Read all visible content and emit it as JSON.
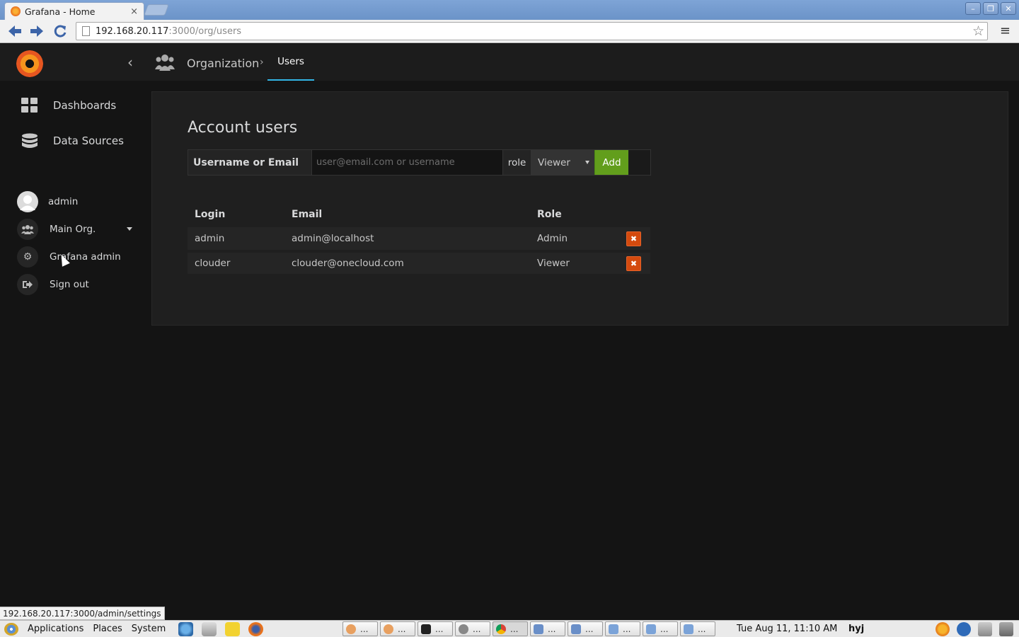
{
  "browser": {
    "tab_title": "Grafana - Home",
    "tab_close": "×",
    "url_host": "192.168.20.117",
    "url_path": ":3000/org/users",
    "status_url": "192.168.20.117:3000/admin/settings",
    "window_buttons": [
      "–",
      "❐",
      "✕"
    ]
  },
  "sidebar": {
    "items": [
      {
        "label": "Dashboards",
        "icon": "dashboards-icon"
      },
      {
        "label": "Data Sources",
        "icon": "database-icon"
      }
    ],
    "user": {
      "name": "admin",
      "org": "Main Org.",
      "admin": "Grafana admin",
      "signout": "Sign out"
    }
  },
  "topnav": {
    "section": "Organization",
    "page": "Users"
  },
  "main": {
    "title": "Account users",
    "invite": {
      "label": "Username or Email",
      "placeholder": "user@email.com or username",
      "role_label": "role",
      "role_value": "Viewer",
      "add_label": "Add"
    },
    "table": {
      "columns": [
        "Login",
        "Email",
        "Role"
      ],
      "rows": [
        {
          "login": "admin",
          "email": "admin@localhost",
          "role": "Admin"
        },
        {
          "login": "clouder",
          "email": "clouder@onecloud.com",
          "role": "Viewer"
        }
      ]
    }
  },
  "taskbar": {
    "menus": [
      "Applications",
      "Places",
      "System"
    ],
    "task_ellipsis": "...",
    "clock": "Tue Aug 11, 11:10 AM",
    "user": "hyj"
  },
  "colors": {
    "accent": "#33b5e5",
    "add_button": "#629e1c",
    "delete_button": "#d44a0e",
    "background": "#141414"
  }
}
